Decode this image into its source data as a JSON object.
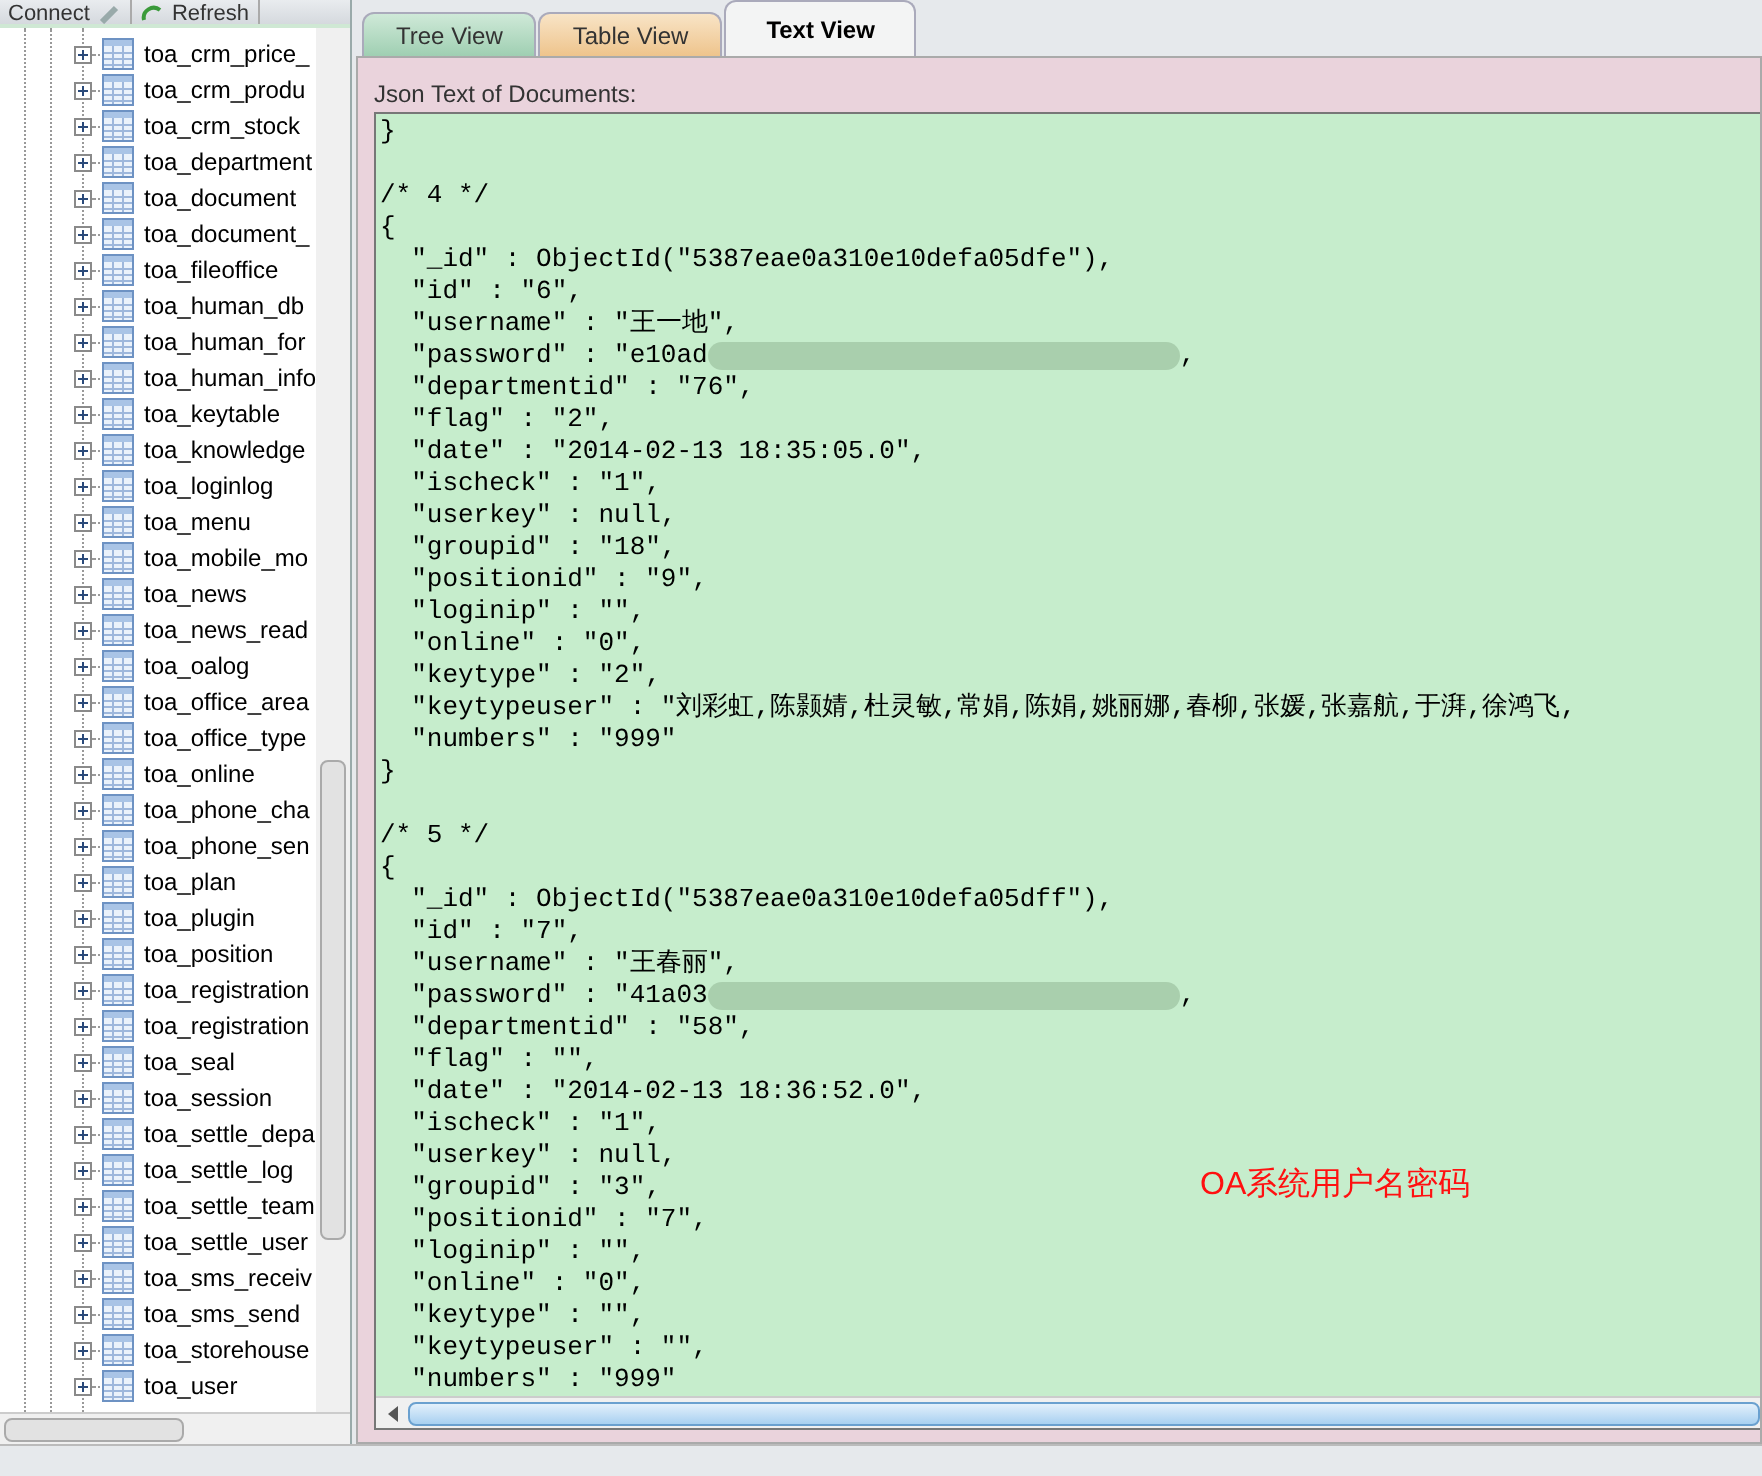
{
  "toolbar": [
    {
      "label": "Connect"
    },
    {
      "label": "Refresh"
    }
  ],
  "tree": {
    "items": [
      {
        "label": "toa_crm_price_"
      },
      {
        "label": "toa_crm_produ"
      },
      {
        "label": "toa_crm_stock"
      },
      {
        "label": "toa_department"
      },
      {
        "label": "toa_document"
      },
      {
        "label": "toa_document_"
      },
      {
        "label": "toa_fileoffice"
      },
      {
        "label": "toa_human_db"
      },
      {
        "label": "toa_human_for"
      },
      {
        "label": "toa_human_info"
      },
      {
        "label": "toa_keytable"
      },
      {
        "label": "toa_knowledge"
      },
      {
        "label": "toa_loginlog"
      },
      {
        "label": "toa_menu"
      },
      {
        "label": "toa_mobile_mo"
      },
      {
        "label": "toa_news"
      },
      {
        "label": "toa_news_read"
      },
      {
        "label": "toa_oalog"
      },
      {
        "label": "toa_office_area"
      },
      {
        "label": "toa_office_type"
      },
      {
        "label": "toa_online"
      },
      {
        "label": "toa_phone_cha"
      },
      {
        "label": "toa_phone_sen"
      },
      {
        "label": "toa_plan"
      },
      {
        "label": "toa_plugin"
      },
      {
        "label": "toa_position"
      },
      {
        "label": "toa_registration"
      },
      {
        "label": "toa_registration"
      },
      {
        "label": "toa_seal"
      },
      {
        "label": "toa_session"
      },
      {
        "label": "toa_settle_depa"
      },
      {
        "label": "toa_settle_log"
      },
      {
        "label": "toa_settle_team"
      },
      {
        "label": "toa_settle_user"
      },
      {
        "label": "toa_sms_receiv"
      },
      {
        "label": "toa_sms_send"
      },
      {
        "label": "toa_storehouse"
      },
      {
        "label": "toa_user"
      }
    ]
  },
  "tabs": [
    {
      "label": "Tree View",
      "selected": false
    },
    {
      "label": "Table View",
      "selected": false
    },
    {
      "label": "Text View",
      "selected": true
    }
  ],
  "panel_label": "Json Text of Documents:",
  "lines": [
    {
      "kind": "code",
      "text": "}"
    },
    {
      "kind": "blank"
    },
    {
      "kind": "code",
      "text": "/* 4 */"
    },
    {
      "kind": "code",
      "text": "{"
    },
    {
      "kind": "code",
      "text": "  \"_id\" : ObjectId(\"5387eae0a310e10defa05dfe\"),"
    },
    {
      "kind": "code",
      "text": "  \"id\" : \"6\","
    },
    {
      "kind": "code",
      "text": "  \"username\" : \"王一地\","
    },
    {
      "kind": "redacted",
      "text": "  \"password\" : \"e10ad",
      "after": ","
    },
    {
      "kind": "code",
      "text": "  \"departmentid\" : \"76\","
    },
    {
      "kind": "code",
      "text": "  \"flag\" : \"2\","
    },
    {
      "kind": "code",
      "text": "  \"date\" : \"2014-02-13 18:35:05.0\","
    },
    {
      "kind": "code",
      "text": "  \"ischeck\" : \"1\","
    },
    {
      "kind": "code",
      "text": "  \"userkey\" : null,"
    },
    {
      "kind": "code",
      "text": "  \"groupid\" : \"18\","
    },
    {
      "kind": "code",
      "text": "  \"positionid\" : \"9\","
    },
    {
      "kind": "code",
      "text": "  \"loginip\" : \"\","
    },
    {
      "kind": "code",
      "text": "  \"online\" : \"0\","
    },
    {
      "kind": "code",
      "text": "  \"keytype\" : \"2\","
    },
    {
      "kind": "code",
      "text": "  \"keytypeuser\" : \"刘彩虹,陈颢婧,杜灵敏,常娟,陈娟,姚丽娜,春柳,张媛,张嘉航,于湃,徐鸿飞,"
    },
    {
      "kind": "code",
      "text": "  \"numbers\" : \"999\""
    },
    {
      "kind": "code",
      "text": "}"
    },
    {
      "kind": "blank"
    },
    {
      "kind": "code",
      "text": "/* 5 */"
    },
    {
      "kind": "code",
      "text": "{"
    },
    {
      "kind": "code",
      "text": "  \"_id\" : ObjectId(\"5387eae0a310e10defa05dff\"),"
    },
    {
      "kind": "code",
      "text": "  \"id\" : \"7\","
    },
    {
      "kind": "code",
      "text": "  \"username\" : \"王春丽\","
    },
    {
      "kind": "redacted",
      "text": "  \"password\" : \"41a03",
      "after": ","
    },
    {
      "kind": "code",
      "text": "  \"departmentid\" : \"58\","
    },
    {
      "kind": "code",
      "text": "  \"flag\" : \"\","
    },
    {
      "kind": "code",
      "text": "  \"date\" : \"2014-02-13 18:36:52.0\","
    },
    {
      "kind": "code",
      "text": "  \"ischeck\" : \"1\","
    },
    {
      "kind": "code",
      "text": "  \"userkey\" : null,"
    },
    {
      "kind": "code",
      "text": "  \"groupid\" : \"3\","
    },
    {
      "kind": "code",
      "text": "  \"positionid\" : \"7\","
    },
    {
      "kind": "code",
      "text": "  \"loginip\" : \"\","
    },
    {
      "kind": "code",
      "text": "  \"online\" : \"0\","
    },
    {
      "kind": "code",
      "text": "  \"keytype\" : \"\","
    },
    {
      "kind": "code",
      "text": "  \"keytypeuser\" : \"\","
    },
    {
      "kind": "code",
      "text": "  \"numbers\" : \"999\""
    }
  ],
  "annotation": "OA系统用户名密码"
}
